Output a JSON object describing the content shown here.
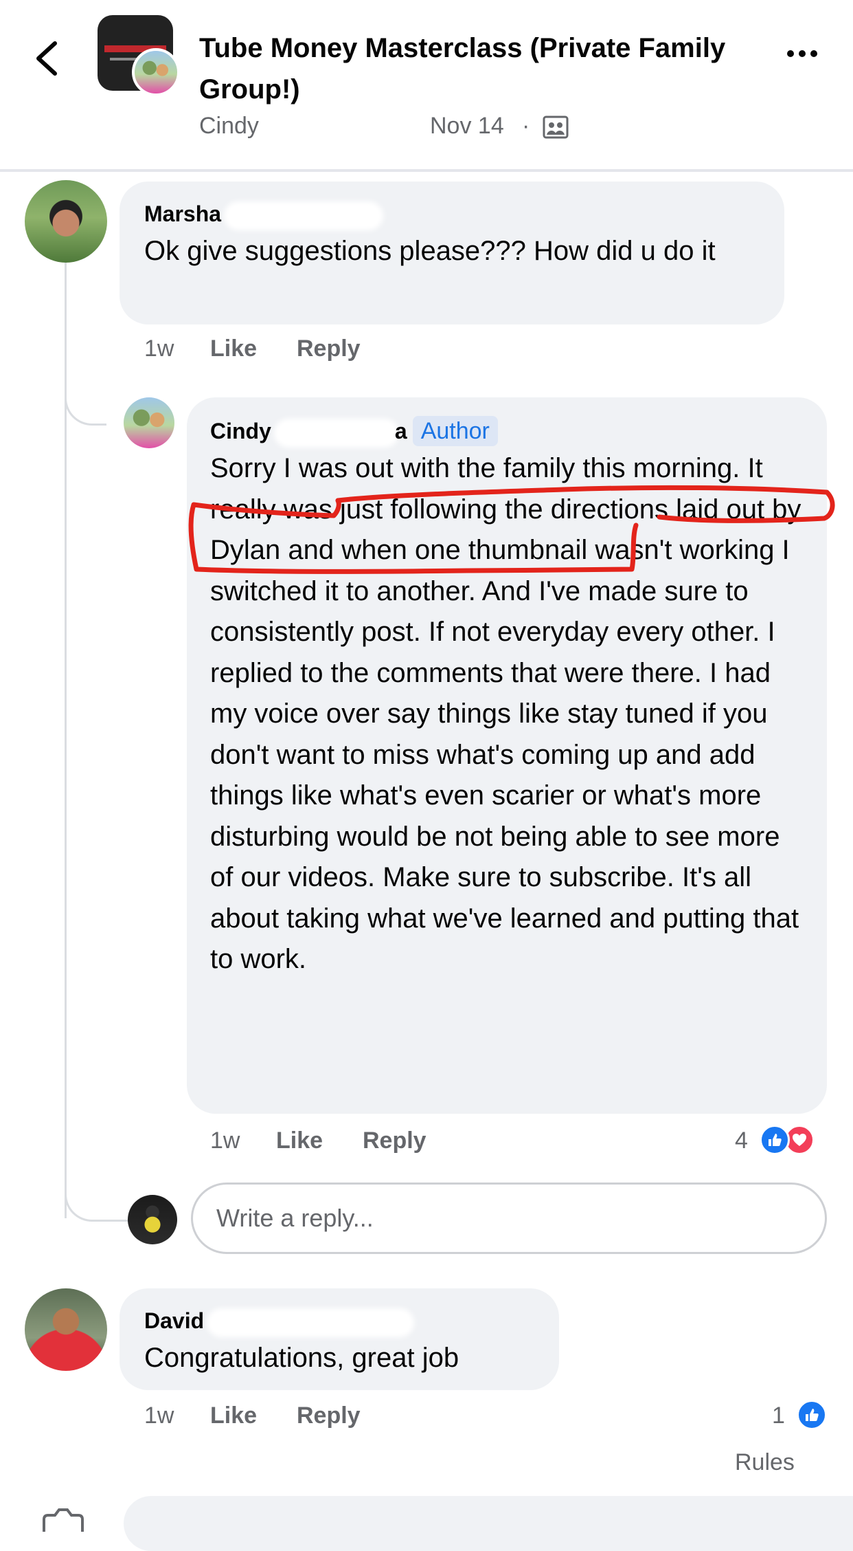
{
  "header": {
    "group_title": "Tube Money Masterclass (Private Family Group!)",
    "post_author": "Cindy",
    "post_date": "Nov 14",
    "separator": "·",
    "privacy_icon": "group-members-icon"
  },
  "comments": [
    {
      "author": "Marsha",
      "text": "Ok give suggestions please??? How did u do it",
      "time": "1w",
      "like_label": "Like",
      "reply_label": "Reply"
    },
    {
      "author_first": "Cindy",
      "author_tail": "a",
      "badge": "Author",
      "text": "Sorry I was out with the family this morning. It really was just following the directions laid out by Dylan and when one thumbnail wasn't working I switched it to another. And I've made sure to consistently post. If not everyday every other. I replied to the comments that were there. I had my voice over say things like stay tuned if you don't want to miss what's coming up and add things like what's even scarier or what's more disturbing would be not being able to see more of our videos. Make sure to subscribe. It's all about taking what we've learned and putting that to work.",
      "time": "1w",
      "like_label": "Like",
      "reply_label": "Reply",
      "reaction_count": "4",
      "reactions": [
        "like-icon",
        "love-icon"
      ]
    },
    {
      "author": "David",
      "text": "Congratulations, great job",
      "time": "1w",
      "like_label": "Like",
      "reply_label": "Reply",
      "reaction_count": "1",
      "reactions": [
        "like-icon"
      ]
    }
  ],
  "reply_box": {
    "placeholder": "Write a reply..."
  },
  "footer": {
    "rules_label": "Rules"
  },
  "colors": {
    "bubble": "#f0f2f5",
    "secondary_text": "#65676b",
    "author_badge_text": "#1b74e4",
    "author_badge_bg": "#dde6f5",
    "like_blue": "#1877f2",
    "love_red": "#f33e58",
    "annotation_red": "#e3241b"
  }
}
